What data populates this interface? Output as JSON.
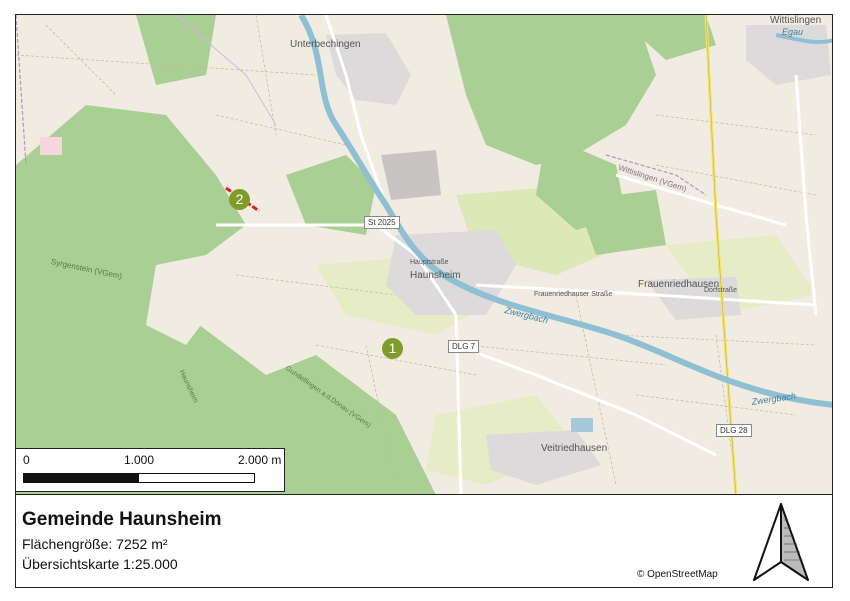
{
  "title": "Gemeinde Haunsheim",
  "area_label": "Flächengröße: 7252 m²",
  "scale_label": "Übersichtskarte 1:25.000",
  "attribution": "© OpenStreetMap",
  "scalebar": {
    "ticks": [
      "0",
      "1.000",
      "2.000 m"
    ]
  },
  "map": {
    "places": {
      "unterbechingen": "Unterbechingen",
      "haunsheim": "Haunsheim",
      "wittislingen": "Wittislingen",
      "frauenriedhausen": "Frauenriedhausen",
      "veitriedhausen": "Veitriedhausen"
    },
    "streets": {
      "hauptstrasse": "Hauptstraße",
      "frauenriedhauser_strasse": "Frauenriedhauser Straße",
      "dorfstrasse": "Dorfstraße",
      "wittislingen_vgem": "Wittislingen (VGem)",
      "syrgenstein_vgem": "Syrgenstein (VGem)",
      "haunsheim_small": "Haunsheim",
      "gundelfingen_vgem": "Gundelfingen a.d.Donau (VGem)"
    },
    "water": {
      "zwergbach_1": "Zwergbach",
      "zwergbach_2": "Zwergbach",
      "egau": "Egau"
    },
    "road_shields": [
      "St 2025",
      "DLG 7",
      "DLG 28"
    ],
    "markers": [
      "1",
      "2"
    ],
    "colors": {
      "forest": "#a9cf95",
      "farmland": "#f1ece1",
      "meadow": "#e6ecc6",
      "residential": "#dcdada",
      "water": "#a6c9d9",
      "marker": "#7f9b2a",
      "site": "#e02020"
    }
  }
}
